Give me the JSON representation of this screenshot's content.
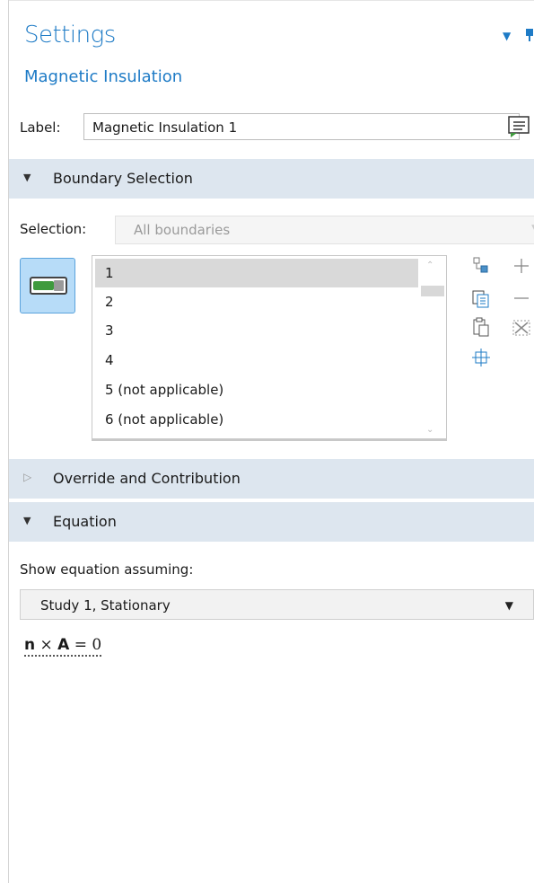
{
  "header": {
    "title": "Settings",
    "subtitle": "Magnetic Insulation"
  },
  "label_row": {
    "label": "Label:",
    "value": "Magnetic Insulation 1"
  },
  "sections": {
    "boundary_selection": "Boundary Selection",
    "override": "Override and Contribution",
    "equation": "Equation"
  },
  "selection": {
    "label": "Selection:",
    "value": "All boundaries"
  },
  "boundary_list": {
    "items": [
      "1",
      "2",
      "3",
      "4",
      "5 (not applicable)",
      "6 (not applicable)"
    ],
    "selected_index": 0
  },
  "equation": {
    "show_label": "Show equation assuming:",
    "study_value": "Study 1, Stationary",
    "n": "n",
    "op": "×",
    "A": "A",
    "rhs": "= 0"
  },
  "colors": {
    "accent": "#1e7bc6",
    "section_bg": "#dde6ef",
    "toggle_bg": "#b7dcf8",
    "toggle_green": "#3f9a3d"
  }
}
